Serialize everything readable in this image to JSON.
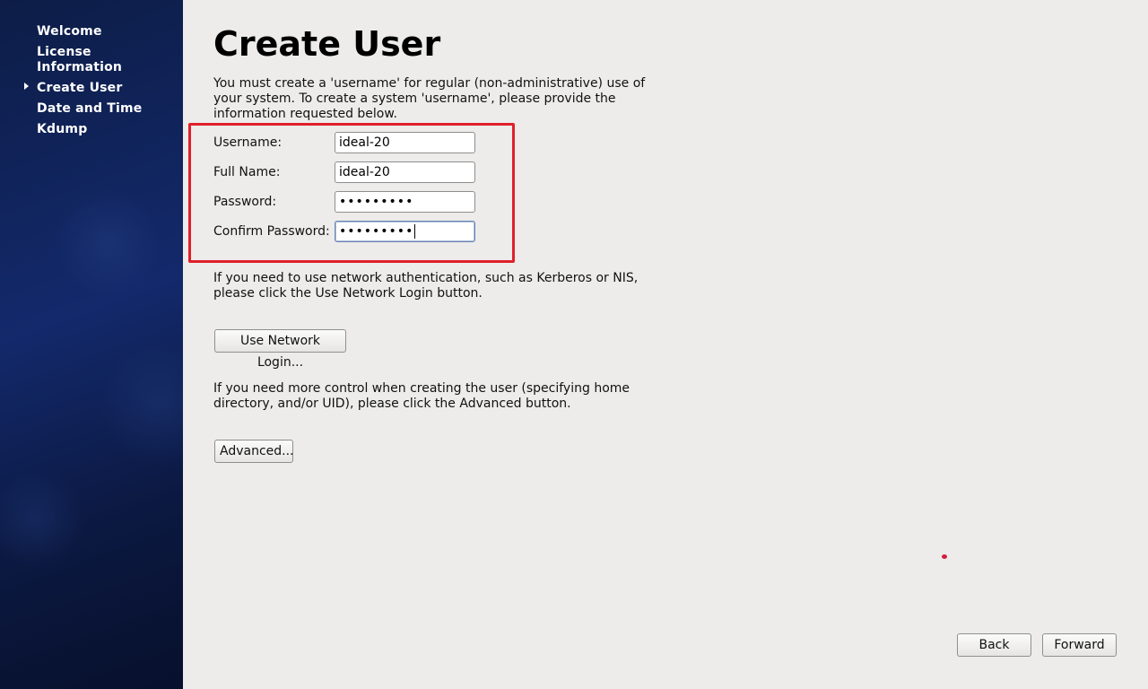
{
  "sidebar": {
    "items": [
      {
        "label": "Welcome"
      },
      {
        "label": "License\nInformation"
      },
      {
        "label": "Create User",
        "active": true
      },
      {
        "label": "Date and Time"
      },
      {
        "label": "Kdump"
      }
    ]
  },
  "main": {
    "title": "Create User",
    "intro": "You must create a 'username' for regular (non-administrative) use of your system.  To create a system 'username', please provide the information requested below.",
    "form": {
      "username": {
        "label": "Username:",
        "value": "ideal-20"
      },
      "full_name": {
        "label": "Full Name:",
        "value": "ideal-20"
      },
      "password": {
        "label": "Password:",
        "value": "•••••••••"
      },
      "confirm_password": {
        "label": "Confirm Password:",
        "value": "•••••••••"
      }
    },
    "network_text": "If you need to use network authentication, such as Kerberos or NIS, please click the Use Network Login button.",
    "network_button": "Use Network Login...",
    "advanced_text": "If you need more control when creating the user (specifying home directory, and/or UID), please click the Advanced button.",
    "advanced_button": "Advanced..."
  },
  "footer": {
    "back_button": "Back",
    "forward_button": "Forward"
  },
  "colors": {
    "sidebar_bg": "#13296b",
    "highlight": "#e0202a",
    "page_bg": "#edeceb"
  }
}
